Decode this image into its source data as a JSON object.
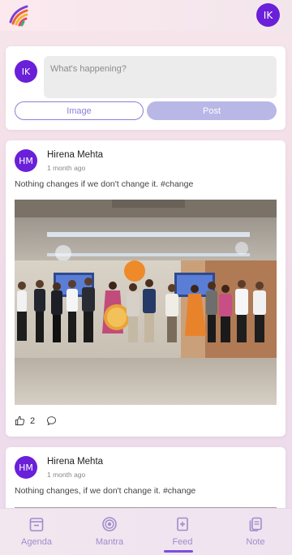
{
  "header": {
    "logo_icon": "rainbow-logo-icon",
    "user_initials": "IK"
  },
  "composer": {
    "user_initials": "IK",
    "placeholder": "What's happening?",
    "image_button_label": "Image",
    "post_button_label": "Post"
  },
  "feed": {
    "posts": [
      {
        "author_initials": "HM",
        "author": "Hirena Mehta",
        "time": "1 month ago",
        "text": "Nothing changes if we don't change it. #change",
        "image_icon": "group-photo",
        "likes": "2",
        "like_icon": "thumbs-up-icon",
        "comment_icon": "comment-icon"
      },
      {
        "author_initials": "HM",
        "author": "Hirena Mehta",
        "time": "1 month ago",
        "text": "Nothing changes, if we don't change it. #change"
      }
    ]
  },
  "bottom_nav": {
    "items": [
      {
        "label": "Agenda",
        "icon": "calendar-icon"
      },
      {
        "label": "Mantra",
        "icon": "target-icon"
      },
      {
        "label": "Feed",
        "icon": "feed-icon",
        "active": true
      },
      {
        "label": "Note",
        "icon": "note-icon"
      }
    ]
  },
  "colors": {
    "accent": "#6a1fd8",
    "nav_label": "#a08ccc",
    "post_button": "#b8b7e6"
  }
}
